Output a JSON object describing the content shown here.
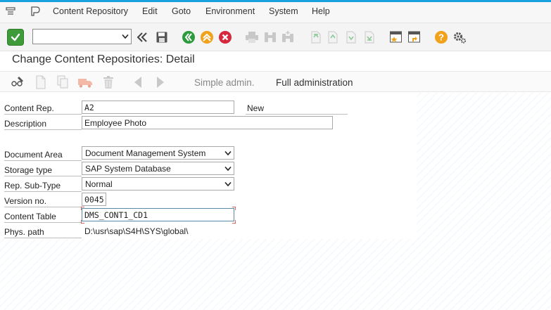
{
  "menu": {
    "items": [
      "Content Repository",
      "Edit",
      "Goto",
      "Environment",
      "System",
      "Help"
    ]
  },
  "toolbar": {
    "command_field_value": ""
  },
  "screen": {
    "title": "Change Content Repositories: Detail"
  },
  "app_toolbar": {
    "simple_admin_label": "Simple admin.",
    "full_admin_label": "Full administration"
  },
  "form": {
    "content_rep": {
      "label": "Content Rep.",
      "value": "A2",
      "status": "New"
    },
    "description": {
      "label": "Description",
      "value": "Employee Photo"
    },
    "document_area": {
      "label": "Document Area",
      "value": "Document Management System"
    },
    "storage_type": {
      "label": "Storage type",
      "value": "SAP System Database"
    },
    "rep_sub_type": {
      "label": "Rep. Sub-Type",
      "value": "Normal"
    },
    "version_no": {
      "label": "Version no.",
      "value": "0045"
    },
    "content_table": {
      "label": "Content Table",
      "value": "DMS_CONT1_CD1"
    },
    "phys_path": {
      "label": "Phys. path",
      "value": "D:\\usr\\sap\\S4H\\SYS\\global\\"
    }
  },
  "colors": {
    "accent": "#1aa1e0",
    "ok_green": "#3f9b3a",
    "nav_green": "#2e9a3e",
    "nav_orange": "#f0a21a",
    "nav_red": "#d7263d",
    "help_orange": "#f0a21a"
  }
}
